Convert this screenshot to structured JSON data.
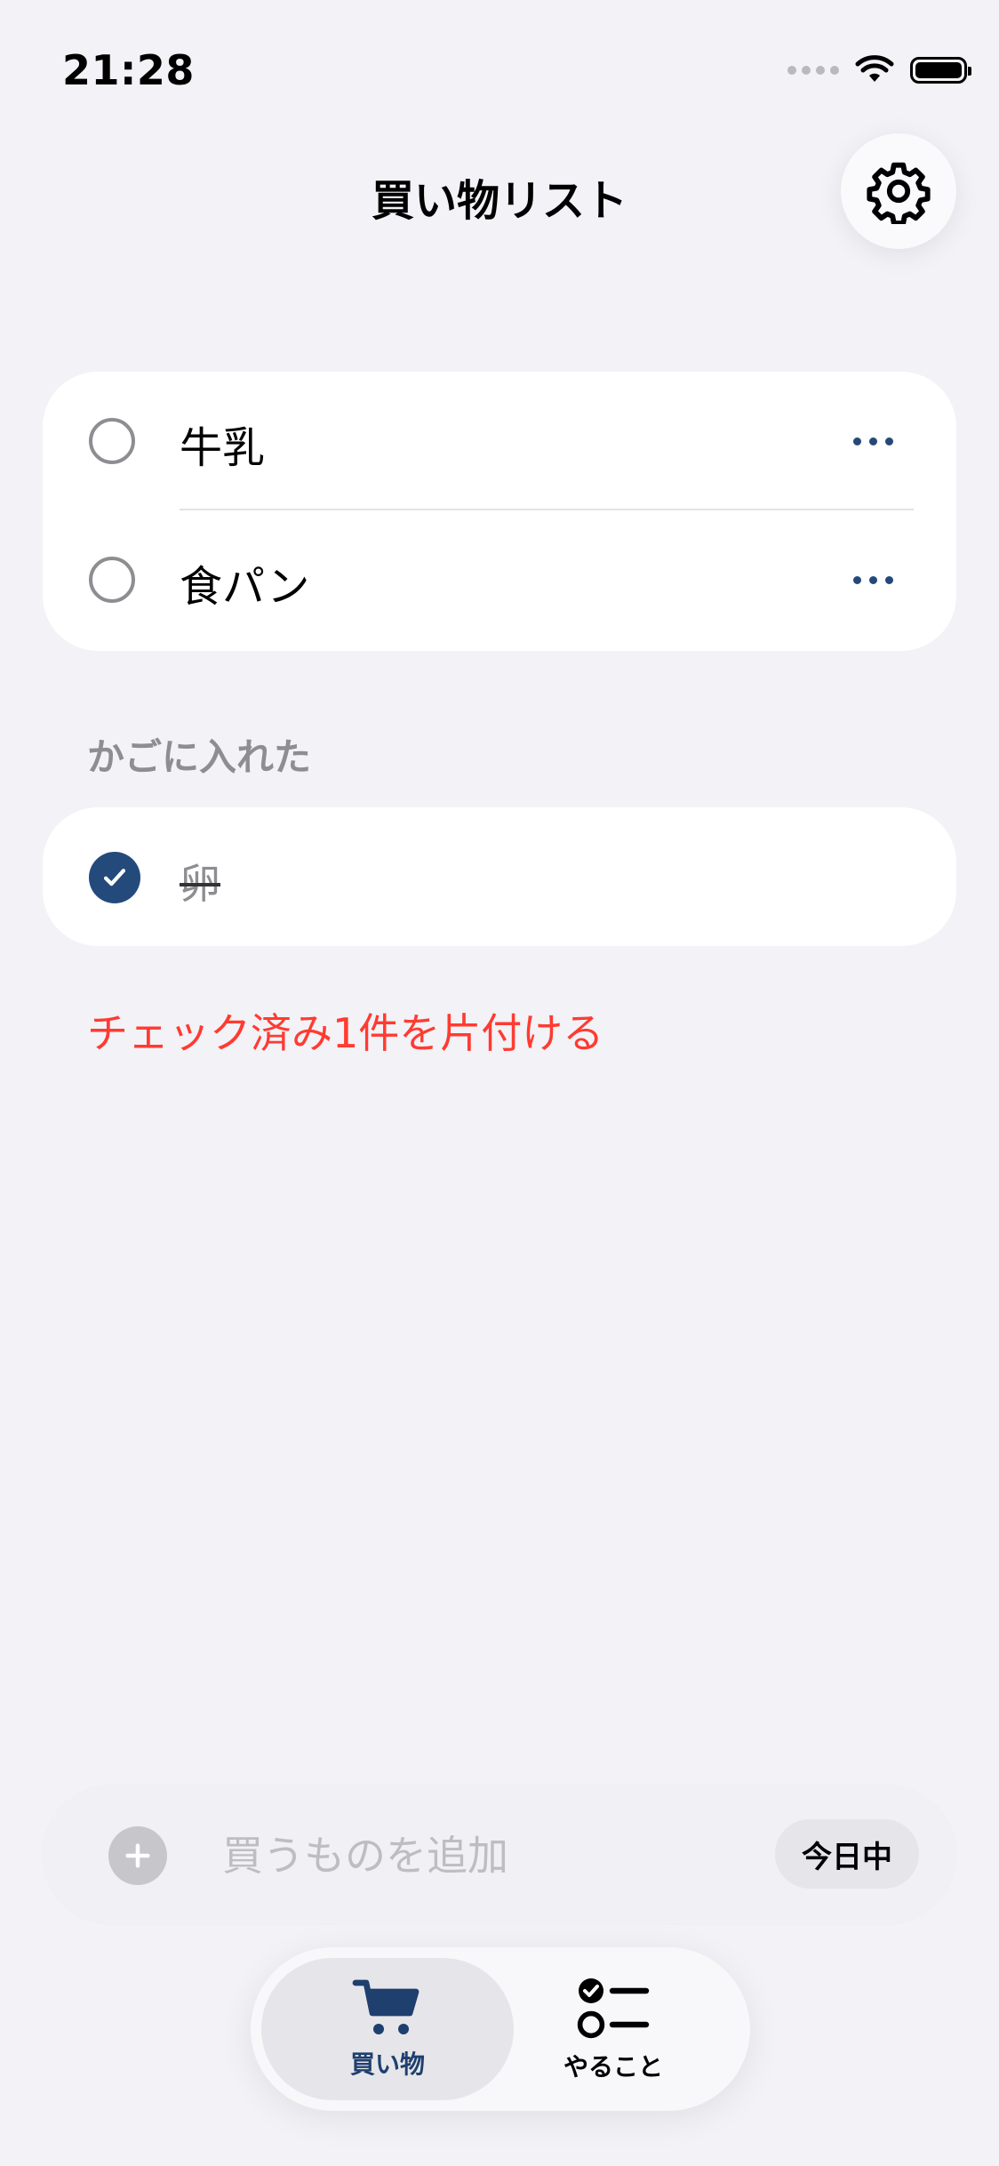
{
  "status_bar": {
    "time": "21:28"
  },
  "header": {
    "title": "買い物リスト"
  },
  "items": [
    {
      "label": "牛乳",
      "checked": false
    },
    {
      "label": "食パン",
      "checked": false
    }
  ],
  "basket": {
    "section_label": "かごに入れた",
    "items": [
      {
        "label": "卵",
        "checked": true
      }
    ]
  },
  "clear_action": "チェック済み1件を片付ける",
  "composer": {
    "placeholder": "買うものを追加",
    "date_chip": "今日中"
  },
  "tabs": [
    {
      "label": "買い物",
      "icon": "cart-icon",
      "active": true
    },
    {
      "label": "やること",
      "icon": "checklist-icon",
      "active": false
    }
  ],
  "colors": {
    "accent": "#244a7c",
    "destructive": "#ff3b30",
    "background": "#f2f2f7"
  }
}
